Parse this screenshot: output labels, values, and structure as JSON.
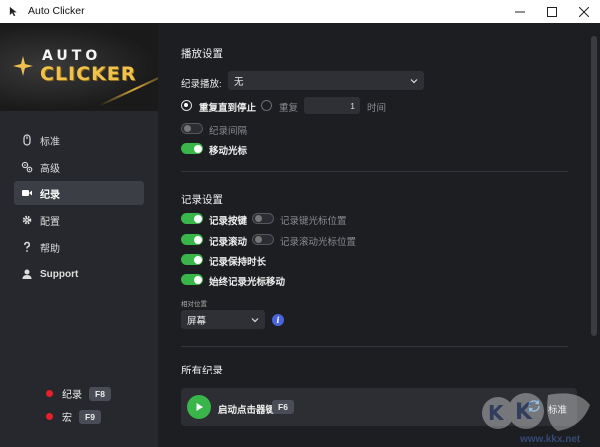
{
  "window": {
    "title": "Auto Clicker"
  },
  "logo": {
    "line1": "AUTO",
    "line2": "CLICKER"
  },
  "sidebar": {
    "items": [
      {
        "label": "标准",
        "icon": "mouse-icon"
      },
      {
        "label": "高级",
        "icon": "cog-cluster-icon"
      },
      {
        "label": "纪录",
        "icon": "video-camera-icon"
      },
      {
        "label": "配置",
        "icon": "gear-icon"
      },
      {
        "label": "帮助",
        "icon": "question-icon"
      },
      {
        "label": "Support",
        "icon": "user-support-icon"
      }
    ],
    "active_index": 2,
    "hotkeys": [
      {
        "label": "纪录",
        "key": "F8"
      },
      {
        "label": "宏",
        "key": "F9"
      }
    ]
  },
  "playback": {
    "title": "播放设置",
    "record_playback_label": "纪录播放:",
    "record_playback_value": "无",
    "repeat_until_stop_label": "重复直到停止",
    "repeat_label": "重复",
    "repeat_count": "1",
    "times_label": "时间",
    "record_interval_label": "纪录间隔",
    "move_cursor_label": "移动光标"
  },
  "recording": {
    "title": "记录设置",
    "record_keys_label": "记录按键",
    "record_key_cursor_pos_label": "记录键光标位置",
    "record_scroll_label": "记录滚动",
    "record_scroll_cursor_pos_label": "记录滚动光标位置",
    "record_hold_time_label": "记录保持时长",
    "always_record_cursor_label": "始终记录光标移动",
    "relative_position_label": "相对位置",
    "relative_position_value": "屏幕"
  },
  "all_records": {
    "title": "所有纪录"
  },
  "bottom": {
    "start_label": "启动点击器键",
    "start_key": "F6",
    "mode_label": "标准"
  },
  "watermark": {
    "url": "www.kkx.net"
  },
  "colors": {
    "accent_green": "#39b54a",
    "record_red": "#e5202a",
    "info_blue": "#4a63d8",
    "logo_gold": "#f0c14b"
  }
}
